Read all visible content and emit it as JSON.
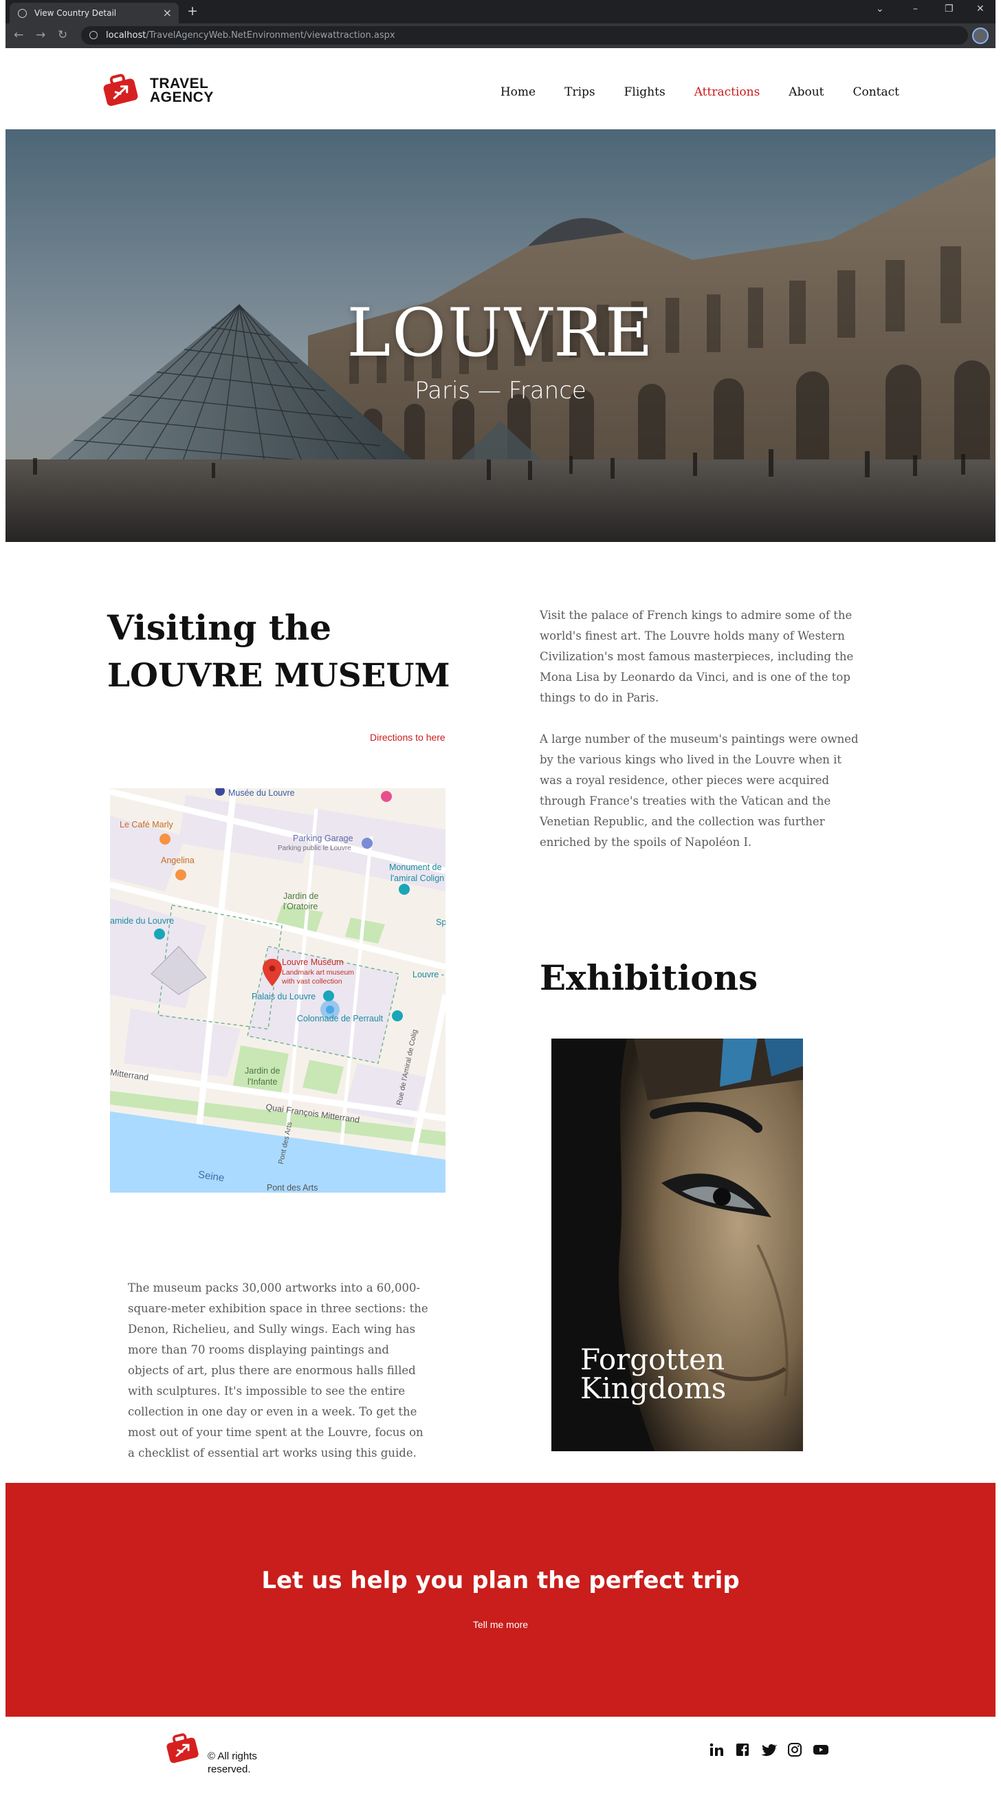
{
  "browser": {
    "tab_title": "View Country Detail",
    "url_host": "localhost",
    "url_path": "/TravelAgencyWeb.NetEnvironment/viewattraction.aspx"
  },
  "header": {
    "logo_line1": "TRAVEL",
    "logo_line2": "AGENCY",
    "nav": [
      "Home",
      "Trips",
      "Flights",
      "Attractions",
      "About",
      "Contact"
    ],
    "active_nav": "Attractions",
    "accent_color": "#c91b1b"
  },
  "hero": {
    "title": "LOUVRE",
    "subtitle": "Paris — France"
  },
  "intro": {
    "heading_line1": "Visiting the",
    "heading_line2": "LOUVRE MUSEUM",
    "directions_link": "Directions to here",
    "paragraph1": "Visit the palace of French kings to admire some of the world's finest art. The Louvre holds many of Western Civilization's most famous masterpieces, including the Mona Lisa by Leonardo da Vinci, and is one of the top things to do in Paris.",
    "paragraph2": "A large number of the museum's paintings were owned by the various kings who lived in the Louvre when it was a royal residence, other pieces were acquired through France's treaties with the Vatican and the Venetian Republic, and the collection was further enriched by the spoils of Napoléon I.",
    "paragraph3": "The museum packs 30,000 artworks into a 60,000-square-meter exhibition space in three sections: the Denon, Richelieu, and Sully wings. Each wing has more than 70 rooms displaying paintings and objects of art, plus there are enormous halls filled with sculptures. It's impossible to see the entire collection in one day or even in a week. To get the most out of your time spent at the Louvre, focus on a checklist of essential art works using this guide."
  },
  "map": {
    "labels": {
      "musee": "Musée du Louvre",
      "cafe": "Le Café Marly",
      "angelina": "Angelina",
      "parking": "Parking Garage",
      "parking_sub": "Parking public le Louvre",
      "monument1": "Monument de",
      "monument2": "l'amiral Colign",
      "jardin_oratoire1": "Jardin de",
      "jardin_oratoire2": "l'Oratoire",
      "pyramide": "amide du Louvre",
      "louvre_pin": "Louvre Museum",
      "louvre_desc1": "Landmark art museum",
      "louvre_desc2": "with vast collection",
      "louvre_right": "Louvre -",
      "palais": "Palais du Louvre",
      "colonnade": "Colonnade de Perrault",
      "jardin_infante1": "Jardin de",
      "jardin_infante2": "l'Infante",
      "quai": "Quai François Mitterrand",
      "mitterrand_left": "Mitterrand",
      "seine": "Seine",
      "pont": "Pont des Arts",
      "pont_bottom": "Pont des Arts",
      "rue": "Rue de l'Amiral de Colig",
      "sp": "Sp"
    }
  },
  "exhibitions": {
    "heading": "Exhibitions",
    "card_title": "Forgotten Kingdoms"
  },
  "cta": {
    "title": "Let us help you plan the perfect trip",
    "button": "Tell me more",
    "color": "#c91e1b"
  },
  "footer": {
    "copyright": "© All rights reserved.",
    "social_icons": [
      "linkedin-icon",
      "facebook-icon",
      "twitter-icon",
      "instagram-icon",
      "youtube-icon"
    ]
  }
}
